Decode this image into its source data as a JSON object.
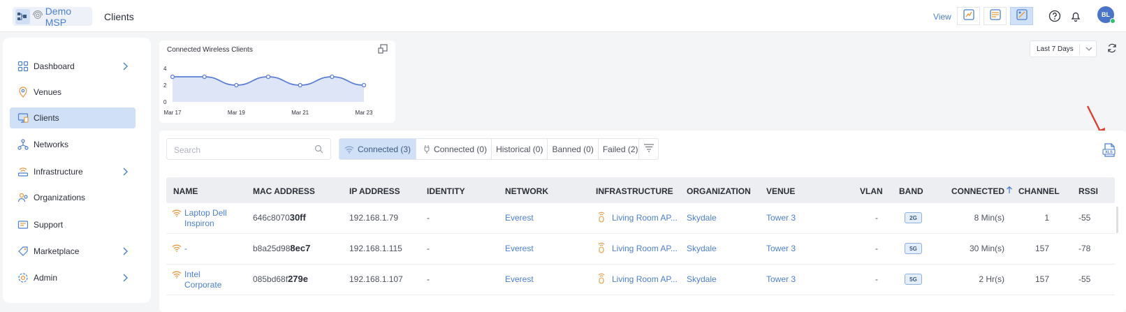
{
  "header": {
    "brand_name": "Demo MSP",
    "page_title": "Clients",
    "view_label": "View",
    "avatar_initials": "BL",
    "icons": [
      "view-analytics-icon",
      "view-map-icon",
      "view-dashboard-icon",
      "help-icon",
      "bell-icon"
    ]
  },
  "sidebar": {
    "items": [
      {
        "label": "Dashboard",
        "icon": "dashboard-icon",
        "has_chevron": true
      },
      {
        "label": "Venues",
        "icon": "location-pin-icon",
        "has_chevron": false
      },
      {
        "label": "Clients",
        "icon": "clients-icon",
        "has_chevron": false,
        "active": true
      },
      {
        "label": "Networks",
        "icon": "networks-icon",
        "has_chevron": false
      },
      {
        "label": "Infrastructure",
        "icon": "infrastructure-icon",
        "has_chevron": true
      },
      {
        "label": "Organizations",
        "icon": "organizations-icon",
        "has_chevron": false
      },
      {
        "label": "Support",
        "icon": "support-icon",
        "has_chevron": false
      },
      {
        "label": "Marketplace",
        "icon": "marketplace-icon",
        "has_chevron": true
      },
      {
        "label": "Admin",
        "icon": "admin-icon",
        "has_chevron": true
      }
    ]
  },
  "chart_card": {
    "title": "Connected Wireless Clients"
  },
  "chart_data": {
    "type": "area",
    "title": "Connected Wireless Clients",
    "x": [
      "Mar 17",
      "Mar 18",
      "Mar 19",
      "Mar 20",
      "Mar 21",
      "Mar 22",
      "Mar 23"
    ],
    "x_tick_labels": [
      "Mar 17",
      "Mar 19",
      "Mar 21",
      "Mar 23"
    ],
    "values": [
      3,
      3,
      2,
      3,
      2,
      3,
      2
    ],
    "y_ticks": [
      "4",
      "2",
      "0"
    ],
    "ylim": [
      0,
      4
    ],
    "color": "#5b7fd6",
    "fill": "#dde5f7"
  },
  "toolbar": {
    "range_value": "Last 7 Days",
    "search_placeholder": "Search"
  },
  "filters": [
    {
      "label": "Connected (3)",
      "icon": "wifi-icon",
      "active": true
    },
    {
      "label": "Connected (0)",
      "icon": "wired-plug-icon",
      "active": false
    },
    {
      "label": "Historical (0)",
      "icon": "",
      "active": false
    },
    {
      "label": "Banned (0)",
      "icon": "",
      "active": false
    },
    {
      "label": "Failed (2)",
      "icon": "",
      "active": false
    }
  ],
  "table": {
    "columns": [
      "NAME",
      "MAC ADDRESS",
      "IP ADDRESS",
      "IDENTITY",
      "NETWORK",
      "INFRASTRUCTURE",
      "ORGANIZATION",
      "VENUE",
      "VLAN",
      "BAND",
      "CONNECTED",
      "CHANNEL",
      "RSSI"
    ],
    "sort_icon": "sort-up-arrow-icon",
    "rows": [
      {
        "name_line1": "Laptop Dell",
        "name_line2": "Inspiron",
        "mac_prefix": "646c8070",
        "mac_suffix": "30ff",
        "ip": "192.168.1.79",
        "identity": "-",
        "network": "Everest",
        "infrastructure": "Living Room AP...",
        "organization": "Skydale",
        "venue": "Tower 3",
        "vlan": "-",
        "band": "2G",
        "connected": "8 Min(s)",
        "channel": "1",
        "rssi": "-55"
      },
      {
        "name_line1": "-",
        "name_line2": "",
        "mac_prefix": "b8a25d98",
        "mac_suffix": "8ec7",
        "ip": "192.168.1.115",
        "identity": "-",
        "network": "Everest",
        "infrastructure": "Living Room AP...",
        "organization": "Skydale",
        "venue": "Tower 3",
        "vlan": "-",
        "band": "5G",
        "connected": "30 Min(s)",
        "channel": "157",
        "rssi": "-78"
      },
      {
        "name_line1": "Intel",
        "name_line2": "Corporate",
        "mac_prefix": "085bd68f",
        "mac_suffix": "279e",
        "ip": "192.168.1.107",
        "identity": "-",
        "network": "Everest",
        "infrastructure": "Living Room AP...",
        "organization": "Skydale",
        "venue": "Tower 3",
        "vlan": "-",
        "band": "5G",
        "connected": "2 Hr(s)",
        "channel": "157",
        "rssi": "-55"
      }
    ]
  },
  "export": {
    "icon": "xls-export-icon",
    "label": "XLS"
  }
}
